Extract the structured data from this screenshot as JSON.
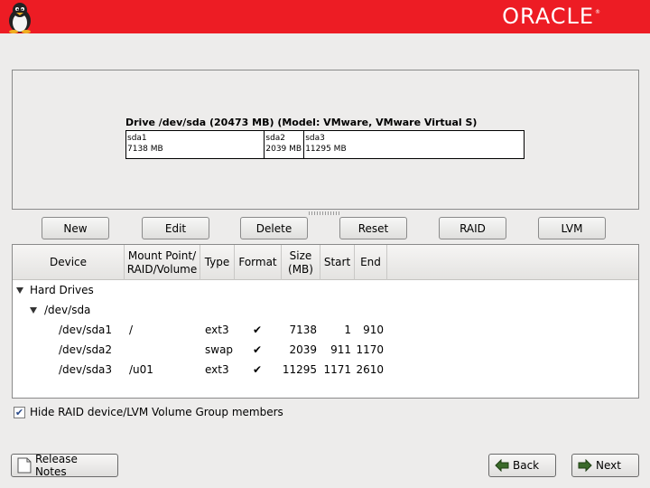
{
  "header": {
    "brand": "ORACLE",
    "brand_mark": "®",
    "logo_icon": "tux-penguin-icon"
  },
  "drive": {
    "title": "Drive /dev/sda (20473 MB) (Model: VMware, VMware Virtual S)",
    "partitions": [
      {
        "name": "sda1",
        "size": "7138 MB",
        "share": 0.3486
      },
      {
        "name": "sda2",
        "size": "2039 MB",
        "share": 0.0996
      },
      {
        "name": "sda3",
        "size": "11295 MB",
        "share": 0.5517
      }
    ]
  },
  "actions": {
    "new": "New",
    "edit": "Edit",
    "delete": "Delete",
    "reset": "Reset",
    "raid": "RAID",
    "lvm": "LVM"
  },
  "table": {
    "columns": {
      "device": "Device",
      "mount1": "Mount Point/",
      "mount2": "RAID/Volume",
      "type": "Type",
      "format": "Format",
      "size1": "Size",
      "size2": "(MB)",
      "start": "Start",
      "end": "End"
    },
    "groups": {
      "hard_drives": "Hard Drives",
      "disk": "/dev/sda"
    },
    "rows": [
      {
        "device": "/dev/sda1",
        "mount": "/",
        "type": "ext3",
        "format": "✔",
        "size": "7138",
        "start": "1",
        "end": "910"
      },
      {
        "device": "/dev/sda2",
        "mount": "",
        "type": "swap",
        "format": "✔",
        "size": "2039",
        "start": "911",
        "end": "1170"
      },
      {
        "device": "/dev/sda3",
        "mount": "/u01",
        "type": "ext3",
        "format": "✔",
        "size": "11295",
        "start": "1171",
        "end": "2610"
      }
    ]
  },
  "options": {
    "hide_raid_label": "Hide RAID device/LVM Volume Group members",
    "hide_raid_checked": "✔"
  },
  "footer": {
    "release_notes": "Release Notes",
    "back": "Back",
    "next": "Next"
  }
}
